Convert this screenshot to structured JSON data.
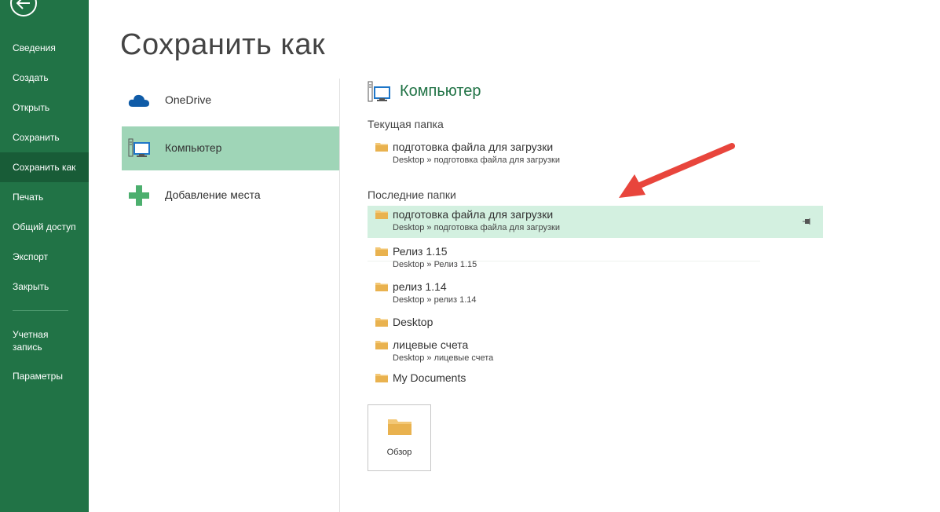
{
  "sidebar": {
    "items": [
      {
        "label": "Сведения"
      },
      {
        "label": "Создать"
      },
      {
        "label": "Открыть"
      },
      {
        "label": "Сохранить"
      },
      {
        "label": "Сохранить как"
      },
      {
        "label": "Печать"
      },
      {
        "label": "Общий доступ"
      },
      {
        "label": "Экспорт"
      },
      {
        "label": "Закрыть"
      }
    ],
    "account_label": "Учетная\nзапись",
    "params_label": "Параметры",
    "active_item": "Сохранить как"
  },
  "page": {
    "title": "Сохранить как"
  },
  "places": [
    {
      "label": "OneDrive",
      "icon": "cloud-icon"
    },
    {
      "label": "Компьютер",
      "icon": "computer-icon"
    },
    {
      "label": "Добавление места",
      "icon": "plus-icon"
    }
  ],
  "right": {
    "section_title": "Компьютер",
    "current_head": "Текущая папка",
    "current_folder": {
      "name": "подготовка файла для загрузки",
      "path": "Desktop » подготовка файла для загрузки"
    },
    "recent_head": "Последние папки",
    "recent_folders": [
      {
        "name": "подготовка файла для загрузки",
        "path": "Desktop » подготовка файла для загрузки"
      },
      {
        "name": "Релиз 1.15",
        "path": "Desktop » Релиз 1.15"
      },
      {
        "name": "релиз 1.14",
        "path": "Desktop » релиз 1.14"
      },
      {
        "name": "Desktop",
        "path": ""
      },
      {
        "name": "лицевые счета",
        "path": "Desktop » лицевые счета"
      },
      {
        "name": "My Documents",
        "path": ""
      }
    ],
    "browse_label": "Обзор"
  },
  "colors": {
    "sidebar": "#217346",
    "active_sidebar": "#185c37",
    "highlight": "#d3f0e0",
    "place_active": "#9fd5b7",
    "annotation_arrow": "#e8453c"
  }
}
